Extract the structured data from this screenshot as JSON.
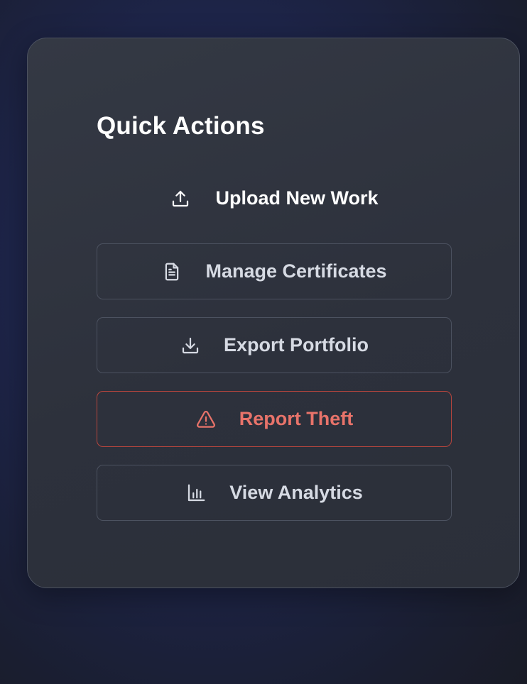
{
  "panel": {
    "title": "Quick Actions",
    "actions": [
      {
        "label": "Upload New Work",
        "icon": "upload-icon"
      },
      {
        "label": "Manage Certificates",
        "icon": "document-icon"
      },
      {
        "label": "Export Portfolio",
        "icon": "download-icon"
      },
      {
        "label": "Report Theft",
        "icon": "warning-icon"
      },
      {
        "label": "View Analytics",
        "icon": "bar-chart-icon"
      }
    ]
  },
  "colors": {
    "danger": "#e8736a",
    "danger_border": "#b8453d",
    "text": "#d6dae3",
    "title": "#ffffff"
  }
}
